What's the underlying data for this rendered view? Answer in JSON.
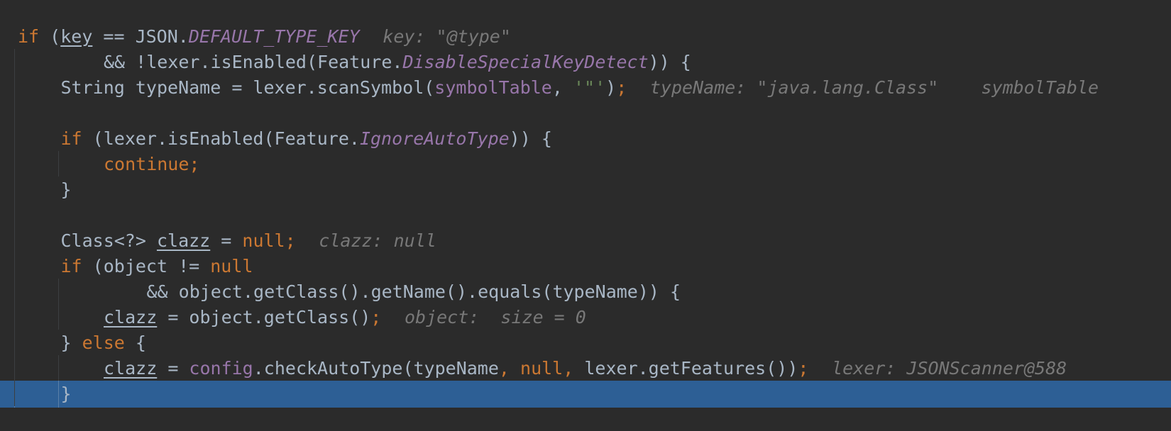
{
  "editor": {
    "language": "java",
    "highlighted_line": 14,
    "lines": [
      {
        "indent": 0,
        "tokens": [
          {
            "t": "if",
            "c": "kw"
          },
          {
            "t": " ("
          },
          {
            "t": "key",
            "c": "u"
          },
          {
            "t": " == JSON."
          },
          {
            "t": "DEFAULT_TYPE_KEY",
            "c": "fld"
          },
          {
            "t": "  "
          },
          {
            "t": "key: \"@type\"",
            "c": "hint"
          }
        ]
      },
      {
        "indent": 2,
        "tokens": [
          {
            "t": "&& !lexer.isEnabled(Feature."
          },
          {
            "t": "DisableSpecialKeyDetect",
            "c": "fld"
          },
          {
            "t": ")) {"
          }
        ]
      },
      {
        "indent": 1,
        "tokens": [
          {
            "t": "String typeName = lexer.scanSymbol("
          },
          {
            "t": "symbolTable",
            "c": "mem"
          },
          {
            "t": ", "
          },
          {
            "t": "'\"'",
            "c": "str"
          },
          {
            "t": ")"
          },
          {
            "t": ";",
            "c": "kw"
          },
          {
            "t": "  "
          },
          {
            "t": "typeName: \"java.lang.Class\"    symbolTable",
            "c": "hint"
          }
        ]
      },
      {
        "indent": 0,
        "tokens": []
      },
      {
        "indent": 1,
        "tokens": [
          {
            "t": "if",
            "c": "kw"
          },
          {
            "t": " (lexer.isEnabled(Feature."
          },
          {
            "t": "IgnoreAutoType",
            "c": "fld"
          },
          {
            "t": ")) {"
          }
        ]
      },
      {
        "indent": 2,
        "tokens": [
          {
            "t": "continue;",
            "c": "kw"
          }
        ]
      },
      {
        "indent": 1,
        "tokens": [
          {
            "t": "}"
          }
        ]
      },
      {
        "indent": 0,
        "tokens": []
      },
      {
        "indent": 1,
        "tokens": [
          {
            "t": "Class<?> "
          },
          {
            "t": "clazz",
            "c": "u"
          },
          {
            "t": " = "
          },
          {
            "t": "null;",
            "c": "kw"
          },
          {
            "t": "  "
          },
          {
            "t": "clazz: null",
            "c": "hint"
          }
        ]
      },
      {
        "indent": 1,
        "tokens": [
          {
            "t": "if",
            "c": "kw"
          },
          {
            "t": " (object != "
          },
          {
            "t": "null",
            "c": "kw"
          }
        ]
      },
      {
        "indent": 3,
        "tokens": [
          {
            "t": "&& object.getClass().getName().equals(typeName)) {"
          }
        ]
      },
      {
        "indent": 2,
        "tokens": [
          {
            "t": "clazz",
            "c": "u"
          },
          {
            "t": " = object.getClass()"
          },
          {
            "t": ";",
            "c": "kw"
          },
          {
            "t": "  "
          },
          {
            "t": "object:  size = 0",
            "c": "hint"
          }
        ]
      },
      {
        "indent": 1,
        "tokens": [
          {
            "t": "} "
          },
          {
            "t": "else",
            "c": "kw"
          },
          {
            "t": " {"
          }
        ]
      },
      {
        "indent": 2,
        "tokens": [
          {
            "t": "clazz",
            "c": "u"
          },
          {
            "t": " = "
          },
          {
            "t": "config",
            "c": "mem"
          },
          {
            "t": ".checkAutoType(typeName"
          },
          {
            "t": ", ",
            "c": "kw"
          },
          {
            "t": "null",
            "c": "kw"
          },
          {
            "t": ", ",
            "c": "kw"
          },
          {
            "t": "lexer.getFeatures())"
          },
          {
            "t": ";",
            "c": "kw"
          },
          {
            "t": "  "
          },
          {
            "t": "lexer: JSONScanner@588",
            "c": "hint"
          }
        ]
      },
      {
        "indent": 1,
        "tokens": [
          {
            "t": "}"
          }
        ]
      }
    ]
  }
}
